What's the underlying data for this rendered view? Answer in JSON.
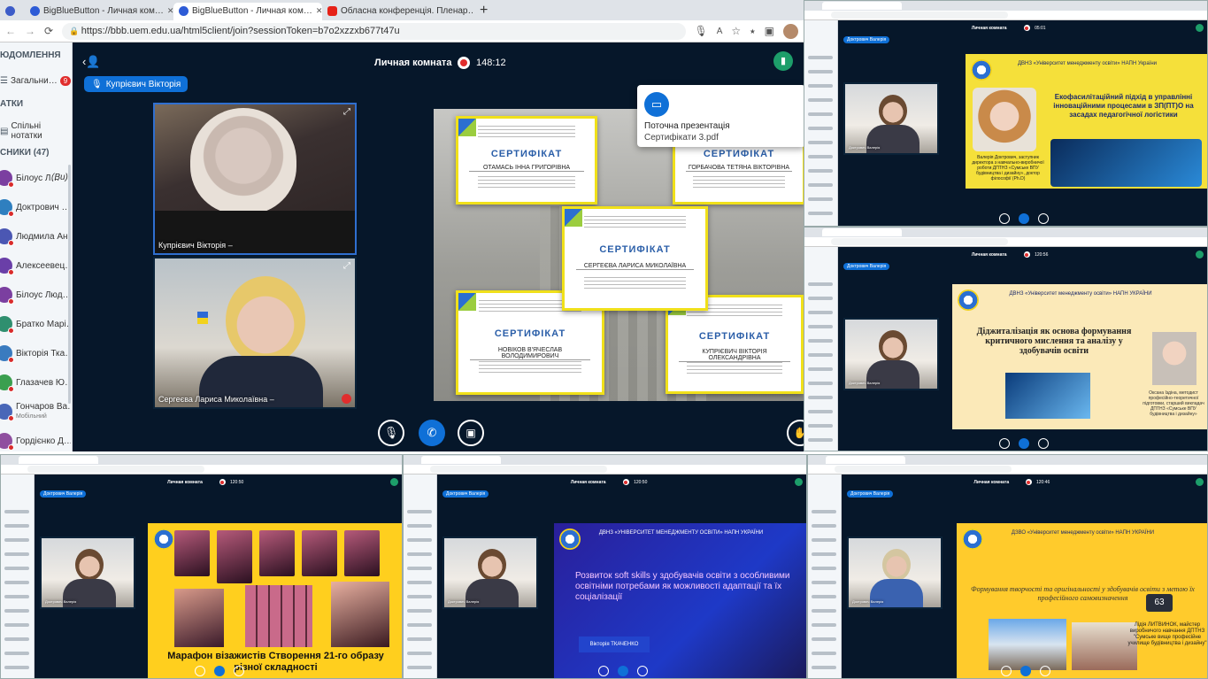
{
  "main": {
    "tabs": [
      {
        "label": "",
        "icon": "bbb-favicon",
        "color": "#3c5cc8"
      },
      {
        "label": "BigBlueButton - Личная ком…",
        "icon": "bbb-favicon",
        "color": "#2d5bd6"
      },
      {
        "label": "BigBlueButton - Личная ком…",
        "icon": "bbb-favicon",
        "color": "#2d5bd6"
      },
      {
        "label": "Обласна конференція. Пленар…",
        "icon": "youtube-icon",
        "color": "#e62117"
      }
    ],
    "new_tab": "+",
    "url": "https://bbb.uem.edu.ua/html5client/join?sessionToken=b7o2xzzxb677t47u",
    "panel_headers": {
      "messages": "ЮДОМЛЕННЯ",
      "notes": "АТКИ",
      "users": "СНИКИ (47)"
    },
    "public_chat": "Загальни…",
    "public_chat_badge": "9",
    "shared_notes": "Спільні нотатки",
    "participants": [
      {
        "name": "Білоус Л…",
        "note": "(Ви)",
        "color": "#7b3fa0"
      },
      {
        "name": "Доктрович …",
        "note": "",
        "color": "#2f7fbf"
      },
      {
        "name": "Людмила Ан…",
        "note": "",
        "color": "#4b57b3"
      },
      {
        "name": "Алексеевец…",
        "note": "",
        "color": "#6a3fa8"
      },
      {
        "name": "Білоус Люд…",
        "note": "",
        "color": "#7b3fa0"
      },
      {
        "name": "Братко Марі…",
        "note": "",
        "color": "#2f8f6f"
      },
      {
        "name": "Вікторія Тка…",
        "note": "",
        "color": "#3a7bbf"
      },
      {
        "name": "Глазачев Ю…",
        "note": "",
        "color": "#3b9f4f"
      },
      {
        "name": "Гончаров Ва…",
        "note": "Мобільний",
        "color": "#4967b8"
      },
      {
        "name": "Гордієнко Д…",
        "note": "",
        "color": "#8f4f9f"
      }
    ],
    "room_title": "Личная комната",
    "timer": "148:12",
    "presenter_pill": "Купрієвич Вікторія",
    "videos": [
      {
        "label": "Купрієвич Вікторія",
        "suffix": "–"
      },
      {
        "label": "Сергеєва Лариса Миколаївна",
        "suffix": "–"
      }
    ],
    "presentation": {
      "title": "Поточна презентація",
      "file": "Сертифікати 3.pdf"
    },
    "certificates": [
      {
        "title": "СЕРТИФІКАТ",
        "name": "ОТАМАСЬ ІННА ГРИГОРІВНА"
      },
      {
        "title": "СЕРТИФІКАТ",
        "name": "ГОРБАЧОВА ТЕТЯНА ВІКТОРІВНА"
      },
      {
        "title": "СЕРТИФІКАТ",
        "name": "СЕРГЕЄВА ЛАРИСА МИКОЛАЇВНА"
      },
      {
        "title": "СЕРТИФІКАТ",
        "name": "НОВІКОВ В'ЯЧЕСЛАВ ВОЛОДИМИРОВИЧ"
      },
      {
        "title": "СЕРТИФІКАТ",
        "name": "КУПРІЄВИЧ ВІКТОРІЯ ОЛЕКСАНДРІВНА"
      }
    ]
  },
  "thumbs": [
    {
      "room": "Личная комната",
      "timer": "05:01",
      "pill": "Доктрович Валерія",
      "video_label": "Доктрович Валерія",
      "slide": {
        "header": "ДВНЗ «Університет менеджменту освіти» НАПН України",
        "title": "Екофасилітаційний підхід в управлінні інноваційними процесами в ЗП(ПТ)О на засадах педагогічної логістики",
        "caption": "Валерія Доктрович, заступник директора з навчально-виробничої роботи ДПТНЗ «Сумське ВПУ будівництва і дизайну», доктор філософії (Ph.D)"
      }
    },
    {
      "room": "Личная комната",
      "timer": "120:56",
      "pill": "Доктрович Валерія",
      "video_label": "Доктрович Валерія",
      "slide": {
        "header": "ДВНЗ «Університет менеджменту освіти» НАПН УКРАЇНИ",
        "title": "Діджиталізація як основа формування критичного мислення та аналізу у здобувачів освіти",
        "caption": "Оксана Іздіна, методист професійно-теоретичної підготовки, старший викладач ДПТНЗ «Сумське ВПУ будівництва і дизайну»"
      }
    },
    {
      "room": "Личная комната",
      "timer": "120:50",
      "pill": "Доктрович Валерія",
      "video_label": "Доктрович Валерія",
      "slide": {
        "header": "",
        "title": "Марафон візажистів Створення 21-го образу різної складності",
        "caption": ""
      }
    },
    {
      "room": "Личная комната",
      "timer": "120:50",
      "pill": "Доктрович Валерія",
      "video_label": "Доктрович Валерія",
      "slide": {
        "header": "ДВНЗ «УНІВЕРСИТЕТ МЕНЕДЖМЕНТУ ОСВІТИ» НАПН УКРАЇНИ",
        "title": "Розвиток soft skills у здобувачів освіти з особливими освітніми потребами як можливості адаптації та їх соціалізації",
        "caption": "Вікторія ТКАЧЕНКО"
      }
    },
    {
      "room": "Личная комната",
      "timer": "120:46",
      "pill": "Доктрович Валерія",
      "video_label": "Доктрович Валерія",
      "slide": {
        "header": "ДЗВО «Університет менеджменту освіти» НАПН УКРАЇНИ",
        "title": "Формування творчості та оригінальності у здобувачів освіти з метою їх професійного самовизначення",
        "caption": "Лідія ЛИТВИНОК, майстер виробничого навчання ДПТНЗ \"Сумське вище професійне училище будівництва і дизайну\"",
        "badge": "63"
      }
    }
  ]
}
